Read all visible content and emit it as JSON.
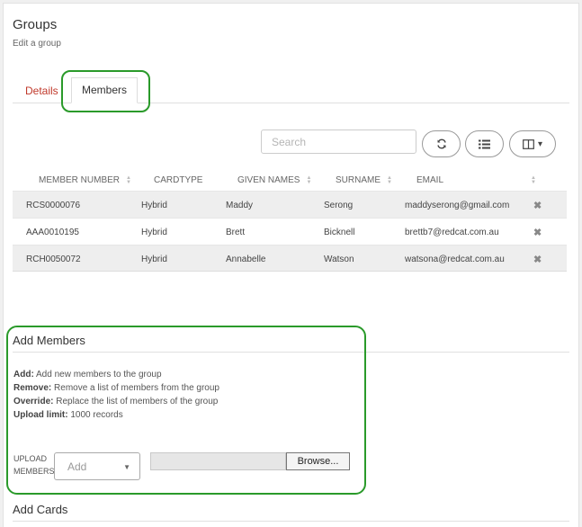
{
  "header": {
    "title": "Groups",
    "subtitle": "Edit a group"
  },
  "tabs": [
    {
      "label": "Details",
      "active": false,
      "color": "#c0392b"
    },
    {
      "label": "Members",
      "active": true
    }
  ],
  "toolbar": {
    "search_placeholder": "Search",
    "refresh_icon": "refresh-icon",
    "list_icon": "list-icon",
    "columns_icon": "columns-icon"
  },
  "table": {
    "columns": [
      "MEMBER NUMBER",
      "CARDTYPE",
      "GIVEN NAMES",
      "SURNAME",
      "EMAIL"
    ],
    "rows": [
      {
        "member_number": "RCS0000076",
        "cardtype": "Hybrid",
        "given_names": "Maddy",
        "surname": "Serong",
        "email": "maddyserong@gmail.com"
      },
      {
        "member_number": "AAA0010195",
        "cardtype": "Hybrid",
        "given_names": "Brett",
        "surname": "Bicknell",
        "email": "brettb7@redcat.com.au"
      },
      {
        "member_number": "RCH0050072",
        "cardtype": "Hybrid",
        "given_names": "Annabelle",
        "surname": "Watson",
        "email": "watsona@redcat.com.au"
      }
    ],
    "delete_icon": "close-icon"
  },
  "add_members": {
    "title": "Add Members",
    "descriptions": [
      {
        "term": "Add:",
        "text": "Add new members to the group"
      },
      {
        "term": "Remove:",
        "text": "Remove a list of members from the group"
      },
      {
        "term": "Override:",
        "text": "Replace the list of members of the group"
      },
      {
        "term": "Upload limit:",
        "text": "1000 records"
      }
    ],
    "upload_label_line1": "UPLOAD",
    "upload_label_line2": "MEMBERS",
    "select_value": "Add",
    "browse_label": "Browse..."
  },
  "add_cards": {
    "title": "Add Cards"
  },
  "colors": {
    "highlight": "#2a9a2a",
    "accent_red": "#c0392b"
  }
}
